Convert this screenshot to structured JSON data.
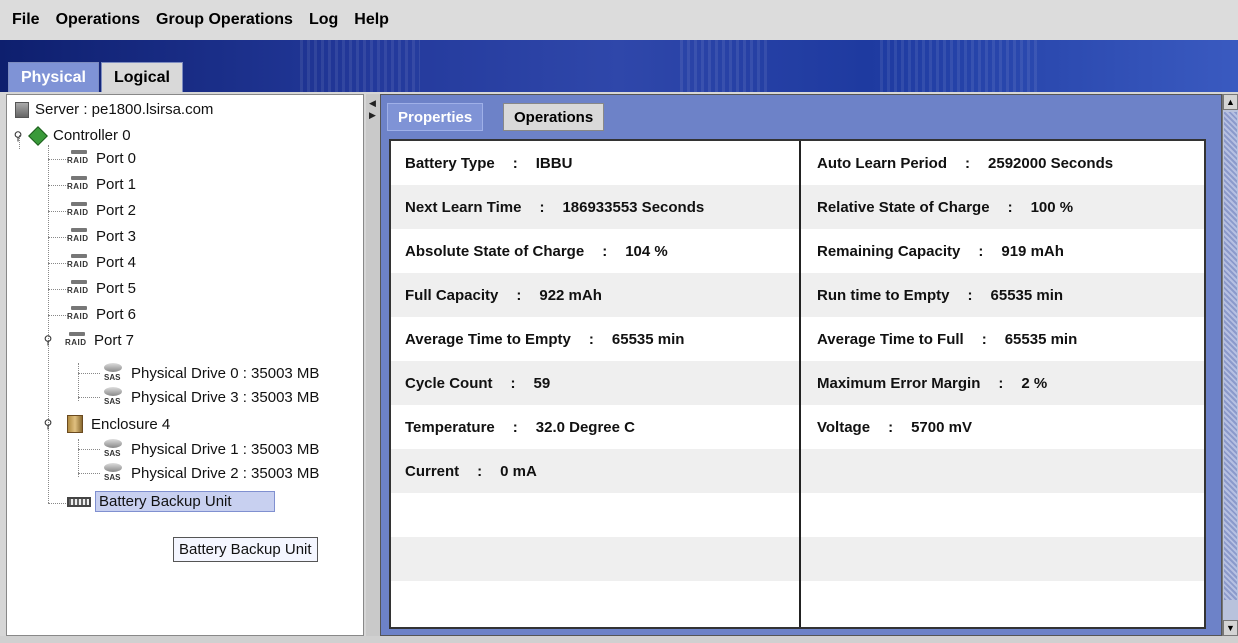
{
  "menu": [
    "File",
    "Operations",
    "Group Operations",
    "Log",
    "Help"
  ],
  "left_tabs": {
    "physical": "Physical",
    "logical": "Logical"
  },
  "tree": {
    "server": "Server : pe1800.lsirsa.com",
    "controller": "Controller 0",
    "raid_label": "RAID",
    "sas_label": "SAS",
    "ports": [
      "Port 0",
      "Port 1",
      "Port 2",
      "Port 3",
      "Port 4",
      "Port 5",
      "Port 6",
      "Port 7"
    ],
    "port7_drives": [
      "Physical Drive 0 : 35003 MB",
      "Physical Drive 3 : 35003 MB"
    ],
    "enclosure": "Enclosure 4",
    "enclosure_drives": [
      "Physical Drive 1 : 35003 MB",
      "Physical Drive 2 : 35003 MB"
    ],
    "battery": "Battery Backup Unit",
    "tooltip": "Battery Backup Unit"
  },
  "right_tabs": {
    "properties": "Properties",
    "operations": "Operations"
  },
  "properties": {
    "left": [
      {
        "label": "Battery Type",
        "value": "IBBU"
      },
      {
        "label": "Next Learn Time",
        "value": "186933553 Seconds"
      },
      {
        "label": "Absolute State of Charge",
        "value": "104 %"
      },
      {
        "label": "Full Capacity",
        "value": "922 mAh"
      },
      {
        "label": "Average Time to Empty",
        "value": "65535 min"
      },
      {
        "label": "Cycle Count",
        "value": "59"
      },
      {
        "label": "Temperature",
        "value": "32.0 Degree C"
      },
      {
        "label": "Current",
        "value": "0 mA"
      }
    ],
    "right": [
      {
        "label": "Auto Learn Period",
        "value": "2592000 Seconds"
      },
      {
        "label": "Relative State of Charge",
        "value": "100 %"
      },
      {
        "label": "Remaining Capacity",
        "value": "919 mAh"
      },
      {
        "label": "Run time to Empty",
        "value": "65535 min"
      },
      {
        "label": "Average Time to Full",
        "value": "65535 min"
      },
      {
        "label": "Maximum Error Margin",
        "value": "2 %"
      },
      {
        "label": "Voltage",
        "value": "5700 mV"
      }
    ],
    "separator": ":"
  }
}
